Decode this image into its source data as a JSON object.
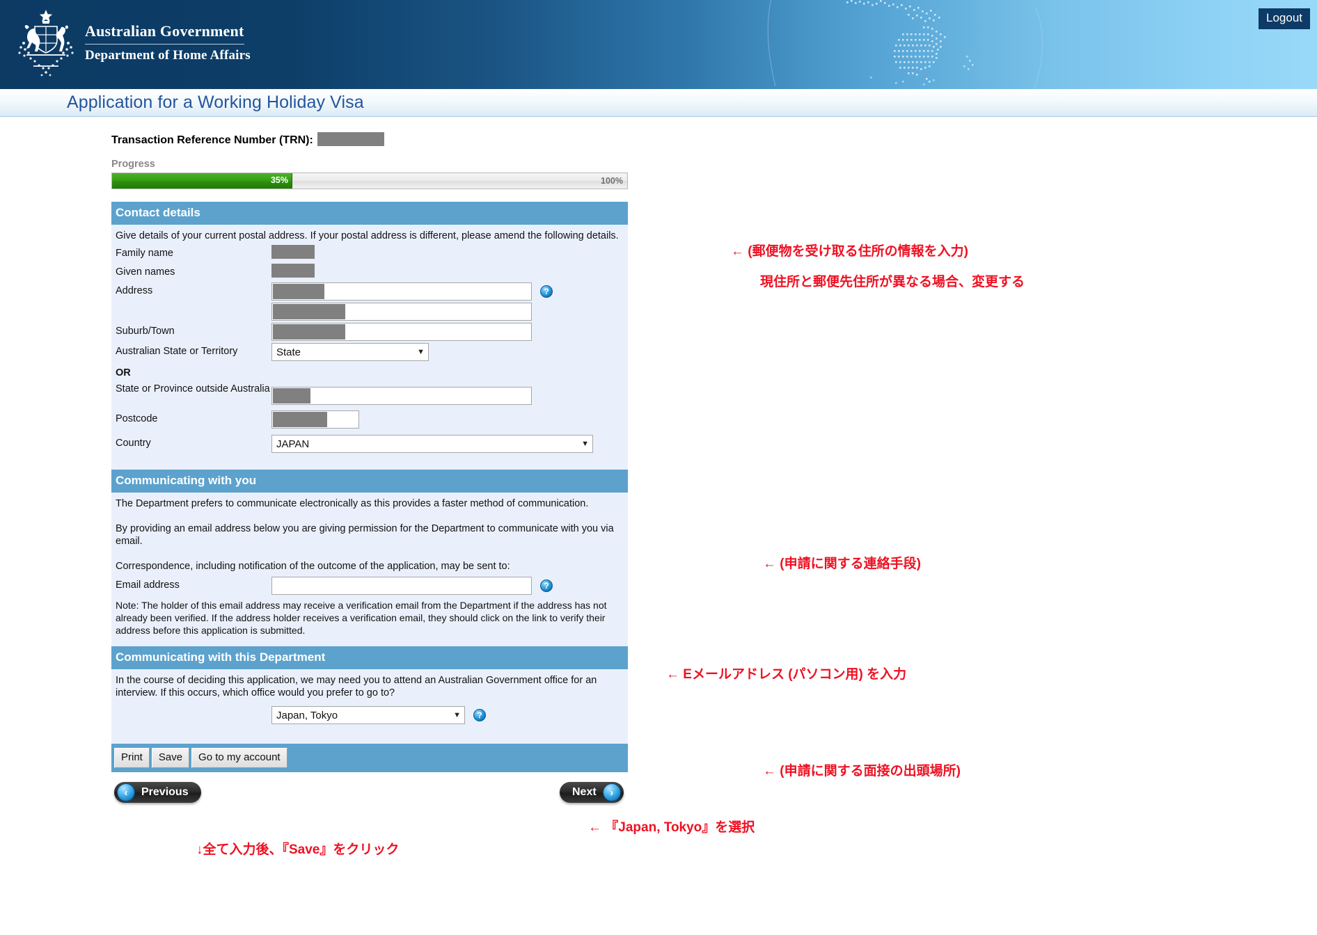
{
  "header": {
    "gov_line1": "Australian Government",
    "gov_line2": "Department of Home Affairs",
    "logout_label": "Logout",
    "crest_icon": "australian-coat-of-arms",
    "map_icon": "dotted-australia-map"
  },
  "page": {
    "title": "Application for a Working Holiday Visa",
    "trn_label": "Transaction Reference Number (TRN):",
    "trn_value": ""
  },
  "progress": {
    "label": "Progress",
    "percent_text": "35%",
    "max_text": "100%",
    "value": 35
  },
  "contact": {
    "section_title": "Contact details",
    "intro": "Give details of your current postal address. If your postal address is different, please amend the following details.",
    "family_name_label": "Family name",
    "family_name_value": "",
    "given_names_label": "Given names",
    "given_names_value": "",
    "address_label": "Address",
    "address_line1_value": "",
    "address_line2_value": "",
    "suburb_label": "Suburb/Town",
    "suburb_value": "",
    "state_label": "Australian State or Territory",
    "state_value": "State",
    "or_label": "OR",
    "province_label": "State or Province outside Australia",
    "province_value": "",
    "postcode_label": "Postcode",
    "postcode_value": "",
    "country_label": "Country",
    "country_value": "JAPAN",
    "help_icon": "help-question-icon"
  },
  "communicating_you": {
    "section_title": "Communicating with you",
    "para1": "The Department prefers to communicate electronically as this provides a faster method of communication.",
    "para2": "By providing an email address below you are giving permission for the Department to communicate with you via email.",
    "para3": "Correspondence, including notification of the outcome of the application, may be sent to:",
    "email_label": "Email address",
    "email_value": "",
    "note": "Note: The holder of this email address may receive a verification email from the Department if the address has not already been verified. If the address holder receives a verification email, they should click on the link to verify their address before this application is submitted."
  },
  "communicating_dept": {
    "section_title": "Communicating with this Department",
    "para1": "In the course of deciding this application, we may need you to attend an Australian Government office for an interview. If this occurs, which office would you prefer to go to?",
    "office_value": "Japan, Tokyo"
  },
  "buttons": {
    "print": "Print",
    "save": "Save",
    "account": "Go to my account",
    "previous": "Previous",
    "next": "Next",
    "prev_icon": "chevron-left-icon",
    "next_icon": "chevron-right-icon"
  },
  "annotations": {
    "a1": "← (郵便物を受け取る住所の情報を入力)",
    "a2": "現住所と郵便先住所が異なる場合、変更する",
    "a3": "← (申請に関する連絡手段)",
    "a4": "← Eメールアドレス (パソコン用) を入力",
    "a5": "← (申請に関する面接の出頭場所)",
    "a6": "← 『Japan, Tokyo』を選択",
    "a7": "↓全て入力後、『Save』をクリック"
  },
  "colors": {
    "banner_dark": "#0c3a63",
    "banner_light": "#99d9f8",
    "section_header": "#5ca2cd",
    "panel_body": "#eaf0fb",
    "title_blue": "#24559c",
    "progress_green": "#35a012",
    "annotation_red": "#ee1122",
    "redaction_gray": "#808080"
  }
}
